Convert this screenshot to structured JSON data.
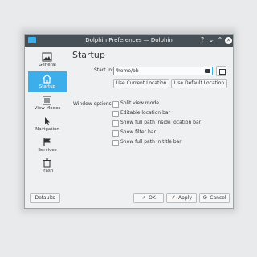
{
  "window": {
    "title": "Dolphin Preferences — Dolphin",
    "controls": {
      "help": "?",
      "minimize": "⌄",
      "maximize": "⌃",
      "close": "×"
    }
  },
  "sidebar": {
    "items": [
      {
        "label": "General",
        "icon": "image-icon",
        "active": false
      },
      {
        "label": "Startup",
        "icon": "home-icon",
        "active": true
      },
      {
        "label": "View Modes",
        "icon": "list-icon",
        "active": false
      },
      {
        "label": "Navigation",
        "icon": "cursor-icon",
        "active": false
      },
      {
        "label": "Services",
        "icon": "flag-icon",
        "active": false
      },
      {
        "label": "Trash",
        "icon": "trash-icon",
        "active": false
      }
    ]
  },
  "main": {
    "heading": "Startup",
    "start_in_label": "Start in:",
    "start_in_value": "/home/bb",
    "use_current_location": "Use Current Location",
    "use_default_location": "Use Default Location",
    "window_options_label": "Window options:",
    "options": [
      {
        "label": "Split view mode",
        "checked": false
      },
      {
        "label": "Editable location bar",
        "checked": false
      },
      {
        "label": "Show full path inside location bar",
        "checked": false
      },
      {
        "label": "Show filter bar",
        "checked": false
      },
      {
        "label": "Show full path in title bar",
        "checked": false
      }
    ]
  },
  "footer": {
    "defaults": "Defaults",
    "ok": "OK",
    "apply": "Apply",
    "cancel": "Cancel"
  },
  "colors": {
    "titlebar": "#475057",
    "accent": "#3daee9",
    "window_bg": "#eff0f1",
    "text": "#31363b"
  }
}
